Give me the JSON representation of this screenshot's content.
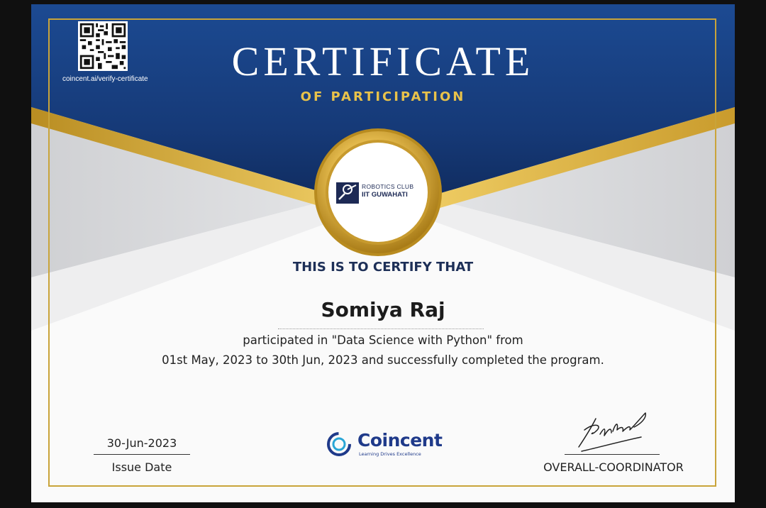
{
  "certificate": {
    "verify_url": "coincent.ai/verify-certificate",
    "title": "CERTIFICATE",
    "subtitle": "OF PARTICIPATION",
    "seal": {
      "line1": "ROBOTICS CLUB",
      "line2": "IIT GUWAHATI",
      "icon": "robotics-club-logo-icon"
    },
    "certify_heading": "THIS IS TO CERTIFY THAT",
    "recipient_name": "Somiya Raj",
    "body_line1": "participated in \"Data Science with Python\" from",
    "body_line2": "01st May, 2023 to 30th Jun, 2023 and successfully completed the program.",
    "issue": {
      "date": "30-Jun-2023",
      "label": "Issue Date"
    },
    "brand": {
      "name": "Coincent",
      "tagline": "Learning Drives Excellence",
      "icon": "coincent-logo-icon"
    },
    "signatory": {
      "role": "OVERALL-COORDINATOR",
      "icon": "signature-icon"
    },
    "colors": {
      "navy": "#173a78",
      "gold": "#d9b245",
      "title_gold": "#e8c24a",
      "heading_navy": "#1d2f57",
      "brand_blue": "#1f3a8a"
    }
  }
}
